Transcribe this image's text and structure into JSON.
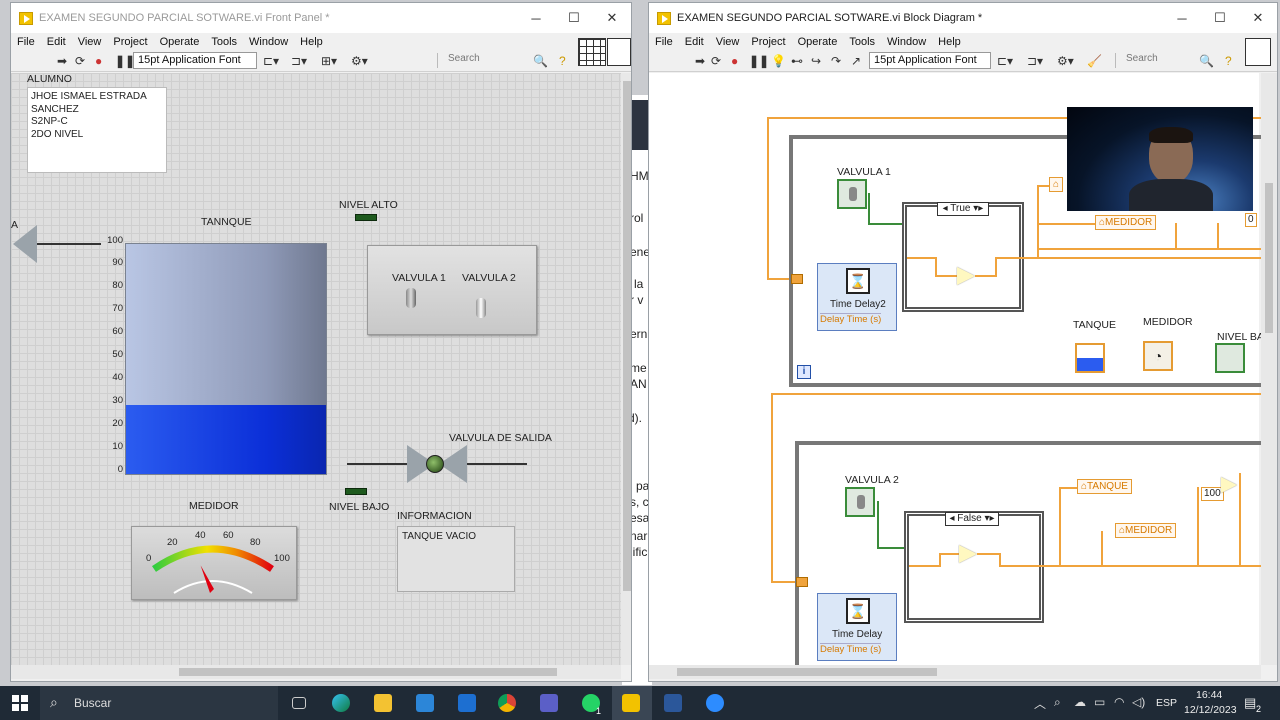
{
  "front_panel": {
    "title": "EXAMEN SEGUNDO PARCIAL SOTWARE.vi Front Panel *",
    "menu": [
      "File",
      "Edit",
      "View",
      "Project",
      "Operate",
      "Tools",
      "Window",
      "Help"
    ],
    "font_select": "15pt Application Font",
    "search_placeholder": "Search",
    "alumno_label": "ALUMNO",
    "alumno_lines": [
      "JHOE ISMAEL ESTRADA",
      "SANCHEZ",
      "S2NP-C",
      "2DO NIVEL"
    ],
    "tank_label": "TANNQUE",
    "tank_level": 30,
    "tank_scale": [
      "100",
      "90",
      "80",
      "70",
      "60",
      "50",
      "40",
      "30",
      "20",
      "10",
      "0"
    ],
    "nivel_alto_label": "NIVEL ALTO",
    "nivel_bajo_label": "NIVEL BAJO",
    "valvula1_label": "VALVULA 1",
    "valvula2_label": "VALVULA 2",
    "valvula_salida_label": "VALVULA DE SALIDA",
    "medidor_label": "MEDIDOR",
    "gauge_ticks": [
      "0",
      "20",
      "40",
      "60",
      "80",
      "100"
    ],
    "gauge_value": 30,
    "informacion_label": "INFORMACION",
    "informacion_value": "TANQUE VACIO",
    "left_edge_label": "A"
  },
  "block_diagram": {
    "title": "EXAMEN SEGUNDO PARCIAL SOTWARE.vi Block Diagram *",
    "menu": [
      "File",
      "Edit",
      "View",
      "Project",
      "Operate",
      "Tools",
      "Window",
      "Help"
    ],
    "font_select": "15pt Application Font",
    "search_placeholder": "Search",
    "loop1": {
      "valvula_label": "VALVULA 1",
      "case_selector": "True",
      "timer_label": "Time Delay2",
      "timer_input": "Delay Time (s)",
      "local_medidor": "MEDIDOR",
      "const": "0"
    },
    "icons_labels": [
      "TANQUE",
      "MEDIDOR",
      "NIVEL BA"
    ],
    "loop2": {
      "valvula_label": "VALVULA 2",
      "case_selector": "False",
      "timer_label": "Time Delay",
      "timer_input": "Delay Time (s)",
      "local_tanque": "TANQUE",
      "local_medidor": "MEDIDOR",
      "const": "100"
    }
  },
  "background_doc_fragments": [
    "HM",
    "rol",
    "ene",
    "la",
    "r v",
    "ern",
    "me",
    "AN",
    "d).",
    "pa",
    "s, c",
    "esa",
    "nar",
    "lific"
  ],
  "taskbar": {
    "search_text": "Buscar",
    "language": "ESP",
    "time": "16:44",
    "date": "12/12/2023",
    "notification_count": "2",
    "whatsapp_badge": "1"
  }
}
